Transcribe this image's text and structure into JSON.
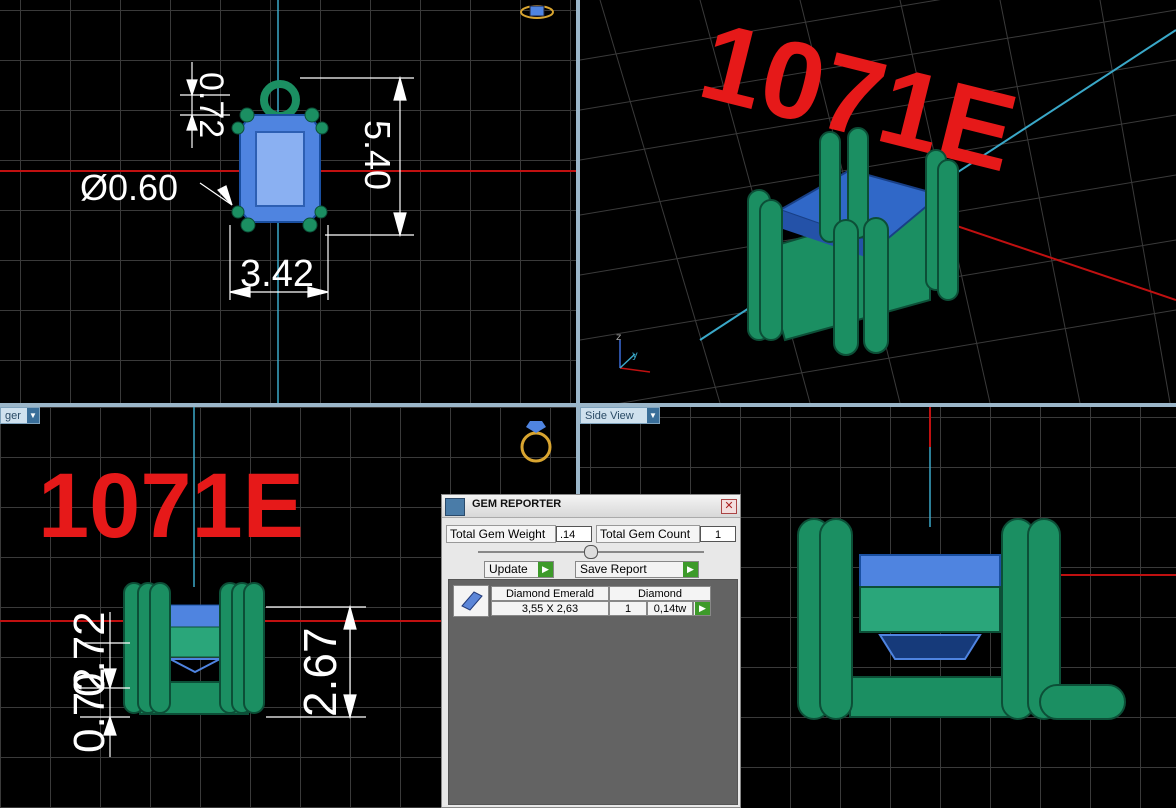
{
  "viewports": {
    "top_left": {
      "dimensions": {
        "d1": "0.72",
        "d2": "5.40",
        "d3": "Ø0.60",
        "d4": "3.42"
      }
    },
    "top_right": {
      "label": "1071E",
      "axis_z": "z",
      "axis_y": "y"
    },
    "bottom_left": {
      "view_label": "ger",
      "label": "1071E",
      "dimensions": {
        "d1": "0.72",
        "d2": "2.67",
        "d3": "0.72"
      }
    },
    "bottom_right": {
      "view_label": "Side View"
    }
  },
  "gem_reporter": {
    "title": "GEM REPORTER",
    "close": "✕",
    "total_weight_label": "Total Gem Weight",
    "total_weight_value": ".14",
    "total_count_label": "Total Gem Count",
    "total_count_value": "1",
    "update_label": "Update",
    "save_label": "Save Report",
    "gems": [
      {
        "name": "Diamond Emerald",
        "size": "3,55 X 2,63",
        "material": "Diamond",
        "count": "1",
        "weight": "0,14tw"
      }
    ]
  },
  "colors": {
    "metal": "#1b8f62",
    "gem": "#4f84e0",
    "label_red": "#e61919",
    "axis_red": "#c01010",
    "axis_cyan": "#3aa8c8"
  }
}
